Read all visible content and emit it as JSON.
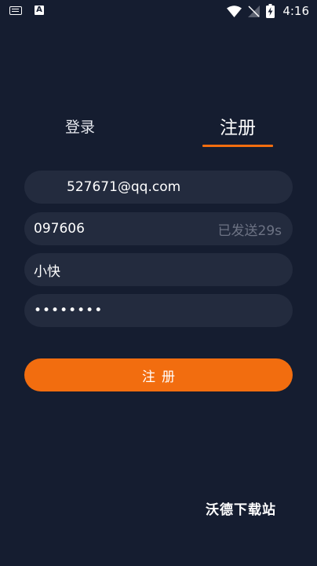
{
  "status_bar": {
    "time": "4:16",
    "icons": [
      "keyboard-icon",
      "a-notification-icon",
      "wifi-icon",
      "signal-off-icon",
      "battery-charging-icon"
    ]
  },
  "tabs": {
    "login_label": "登录",
    "register_label": "注册",
    "active": "register"
  },
  "form": {
    "email": "527671@qq.com",
    "code": "097606",
    "code_status": "已发送29s",
    "nickname": "小快",
    "password": "••••••••"
  },
  "register_button": {
    "label": "注册"
  },
  "watermark": "沃德下载站",
  "colors": {
    "background": "#151d30",
    "field": "#232b3e",
    "accent": "#f26d0f",
    "muted_text": "#6d7384"
  }
}
